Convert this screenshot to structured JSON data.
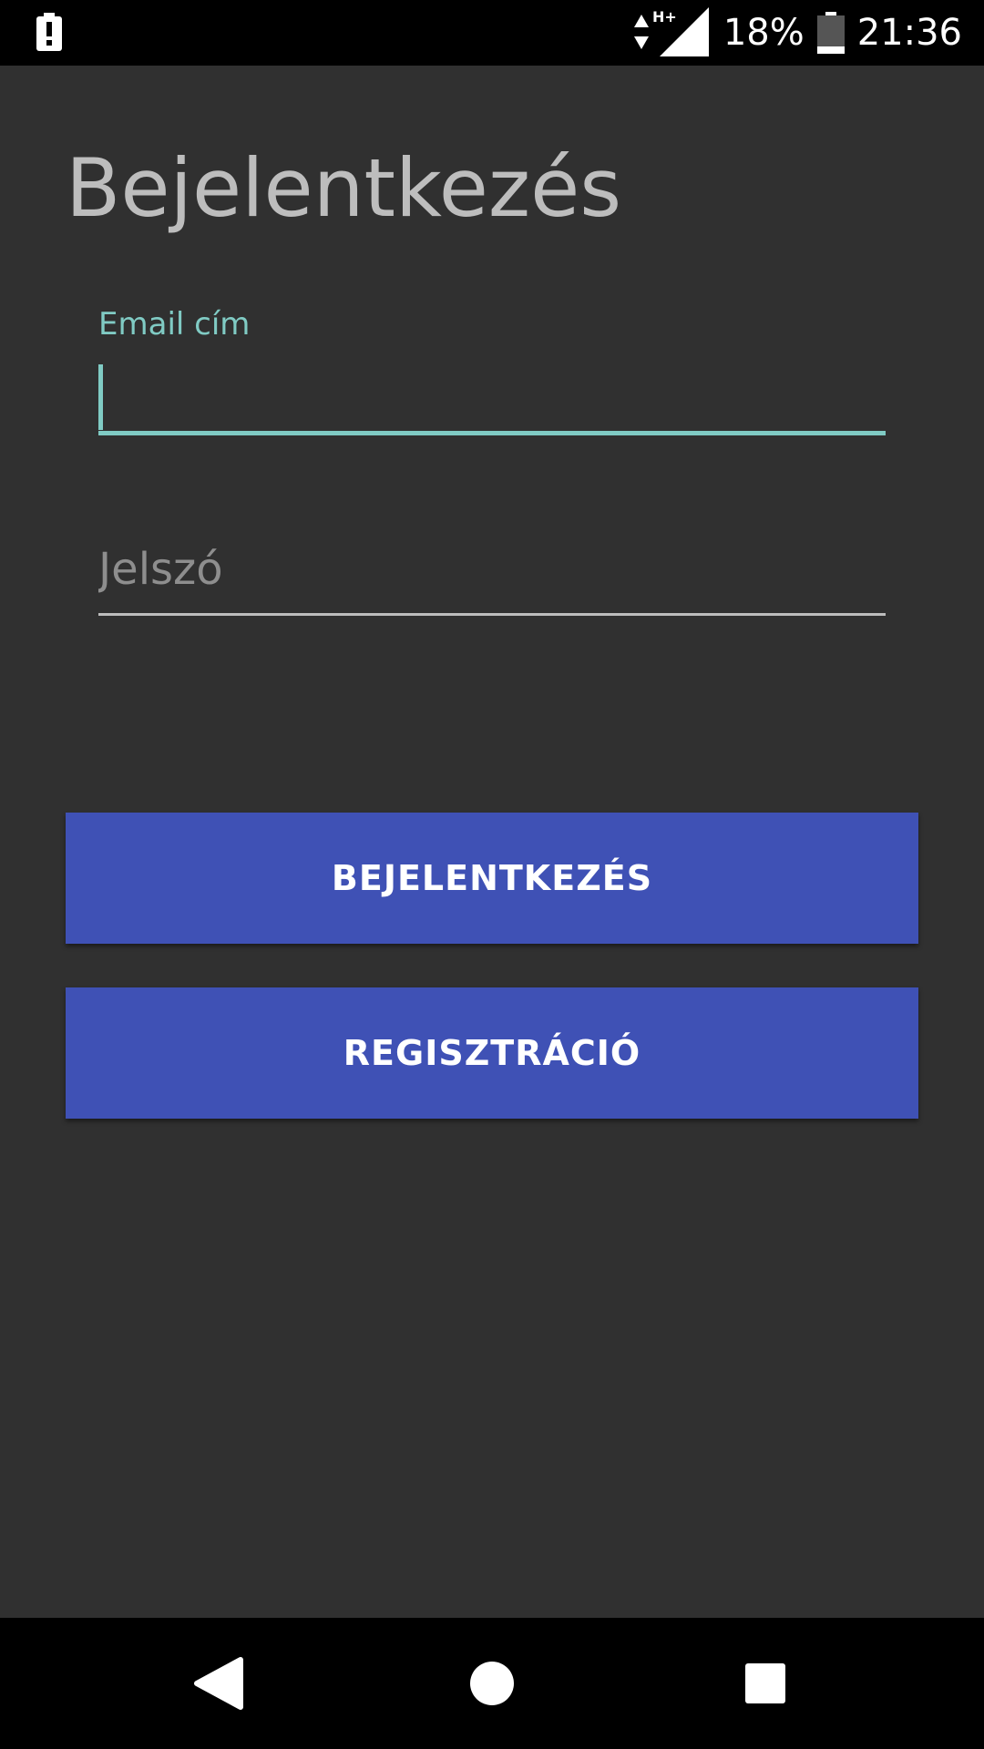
{
  "status_bar": {
    "alert_icon": "battery-alert-icon",
    "network_type": "H+",
    "battery_percent": "18%",
    "battery_level": 0.18,
    "time": "21:36"
  },
  "login": {
    "title": "Bejelentkezés",
    "email_label": "Email cím",
    "email_value": "",
    "password_placeholder": "Jelszó",
    "login_button": "BEJELENTKEZÉS",
    "register_button": "REGISZTRÁCIÓ"
  },
  "nav_bar": {
    "back_icon": "back-icon",
    "home_icon": "home-icon",
    "recents_icon": "recents-icon"
  },
  "colors": {
    "background": "#303030",
    "accent": "#80cbc4",
    "button": "#3f51b5",
    "title_text": "#bdbdbd"
  }
}
